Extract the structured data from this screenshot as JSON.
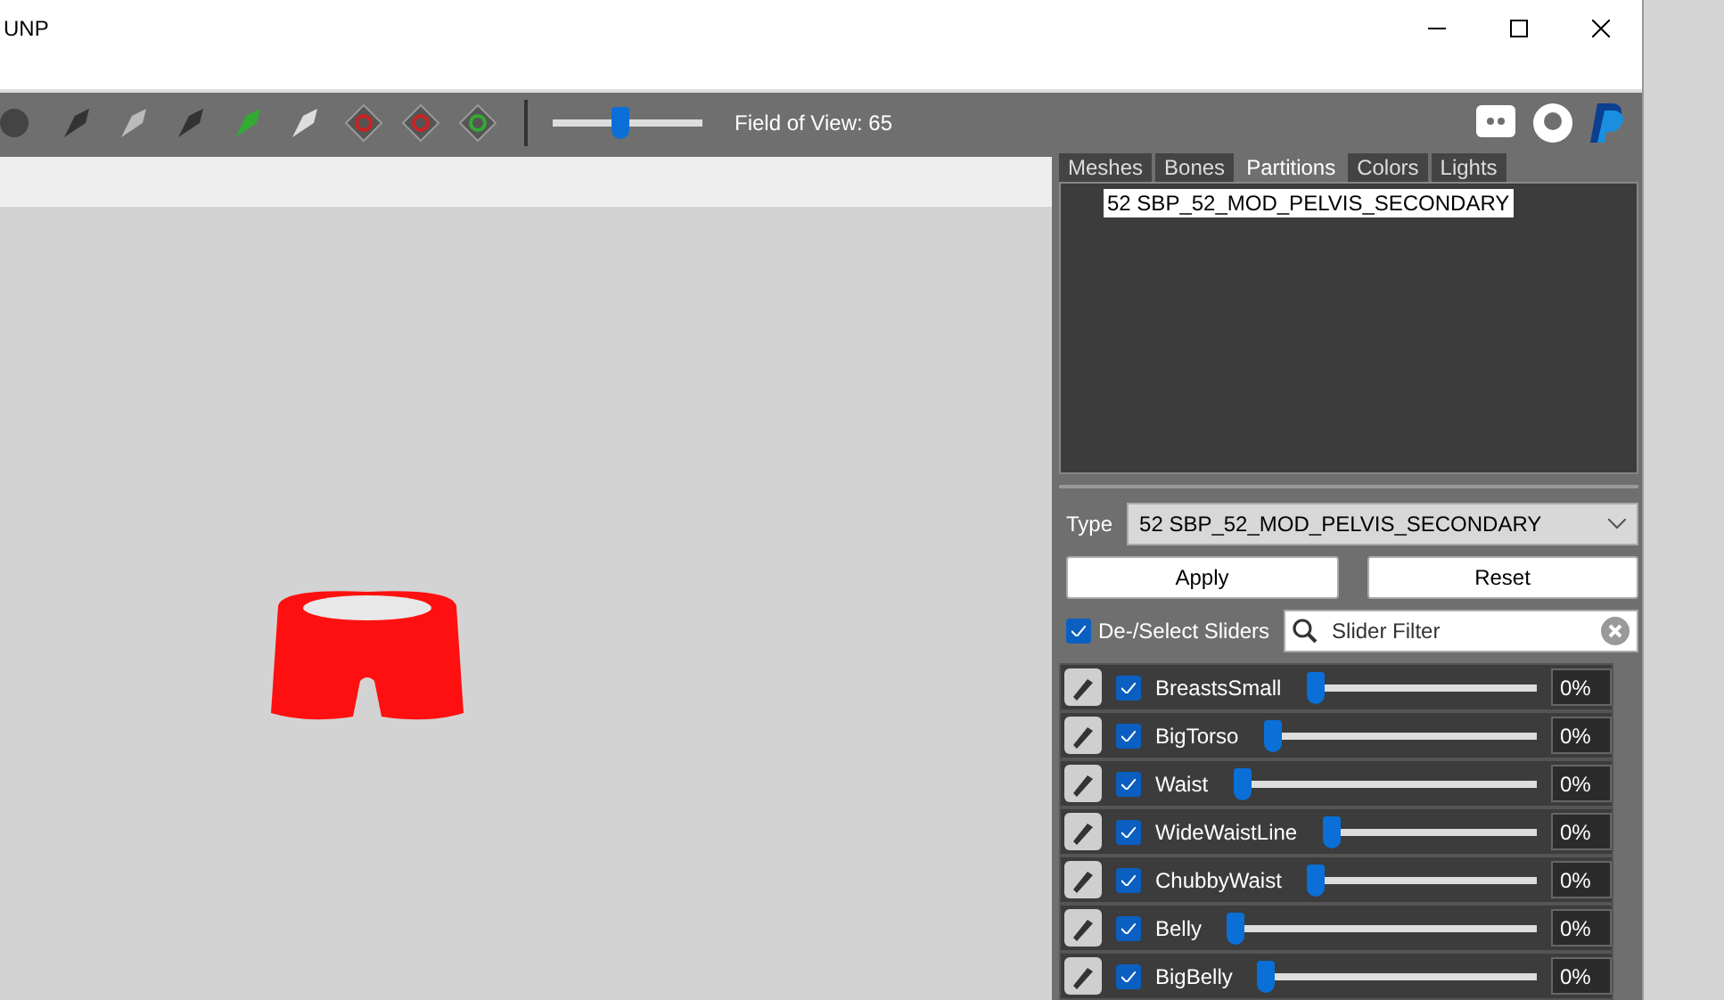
{
  "window": {
    "title": "UNP"
  },
  "toolbar": {
    "fov_slider": {
      "level": 0.45
    },
    "fov_label": "Field of View: 65"
  },
  "tabs": [
    {
      "label": "Meshes",
      "selected": false
    },
    {
      "label": "Bones",
      "selected": false
    },
    {
      "label": "Partitions",
      "selected": true
    },
    {
      "label": "Colors",
      "selected": false
    },
    {
      "label": "Lights",
      "selected": false
    }
  ],
  "partitions": [
    {
      "label": "52 SBP_52_MOD_PELVIS_SECONDARY",
      "selected": true
    }
  ],
  "type_field": {
    "label": "Type",
    "value": "52 SBP_52_MOD_PELVIS_SECONDARY"
  },
  "buttons": [
    "Apply",
    "Reset"
  ],
  "select_sliders": {
    "label": "De-/Select Sliders",
    "checked": true
  },
  "filter": {
    "placeholder": "Slider Filter"
  },
  "sliders": [
    {
      "name": "BreastsSmall",
      "checked": true,
      "level": 0,
      "value": "0%"
    },
    {
      "name": "BigTorso",
      "checked": true,
      "level": 0,
      "value": "0%"
    },
    {
      "name": "Waist",
      "checked": true,
      "level": 0,
      "value": "0%"
    },
    {
      "name": "WideWaistLine",
      "checked": true,
      "level": 0,
      "value": "0%"
    },
    {
      "name": "ChubbyWaist",
      "checked": true,
      "level": 0,
      "value": "0%"
    },
    {
      "name": "Belly",
      "checked": true,
      "level": 0,
      "value": "0%"
    },
    {
      "name": "BigBelly",
      "checked": true,
      "level": 0,
      "value": "0%"
    }
  ]
}
